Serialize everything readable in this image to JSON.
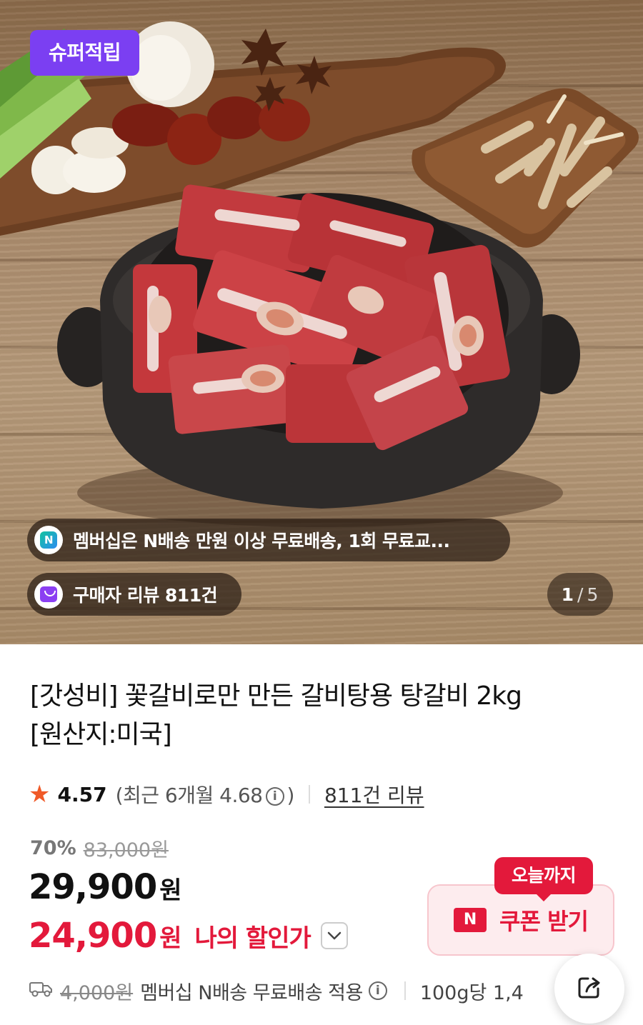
{
  "hero": {
    "badge": "슈퍼적립",
    "membership_notice": "멤버십은 N배송 만원 이상 무료배송, 1회 무료교...",
    "review_count_pill": "구매자 리뷰 811건",
    "image_index": "1",
    "image_separator": "/",
    "image_total": "5"
  },
  "product": {
    "title_line1": "[갓성비] 꽃갈비로만 만든 갈비탕용 탕갈비 2kg",
    "title_line2": "[원산지:미국]"
  },
  "rating": {
    "score": "4.57",
    "recent_prefix": "(최근 6개월 4.68",
    "recent_suffix": ")",
    "info_glyph": "i",
    "review_link": "811건 리뷰"
  },
  "price": {
    "discount_rate": "70%",
    "original_price": "83,000원",
    "sale_amount": "29,900",
    "sale_unit": "원",
    "my_amount": "24,900",
    "my_unit": "원",
    "my_label": "나의 할인가"
  },
  "coupon": {
    "tag": "오늘까지",
    "n_glyph": "N",
    "label": "쿠폰 받기"
  },
  "shipping": {
    "original_fee": "4,000원",
    "text": "멤버십 N배송 무료배송 적용",
    "info_glyph": "i",
    "unit_price": "100g당 1,4"
  },
  "colors": {
    "accent_purple": "#7b3ff2",
    "sale_red": "#e3193b",
    "star_orange": "#f05a28",
    "coupon_bg": "#fdecee"
  },
  "icons": {
    "membership": "naver-n-icon",
    "review": "shopping-bag-icon",
    "rating": "star-icon",
    "info": "info-icon",
    "dropdown": "chevron-down-icon",
    "shipping": "truck-icon",
    "share": "share-icon"
  }
}
